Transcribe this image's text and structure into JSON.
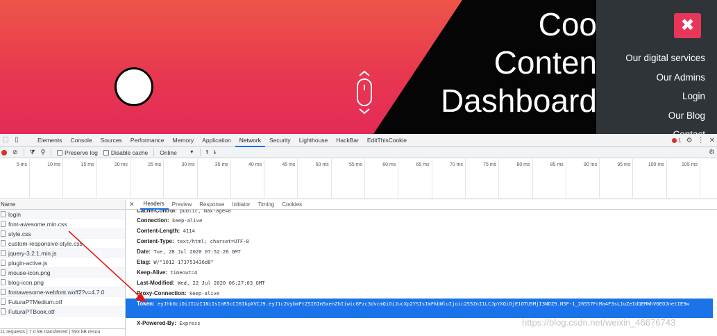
{
  "site": {
    "hero_lines": [
      "Coo",
      "Conten",
      "Dashboard"
    ],
    "menu_close_glyph": "✖",
    "menu_items": [
      "Our digital services",
      "Our Admins",
      "Login",
      "Our Blog",
      "Contact"
    ],
    "colors": {
      "gradient_top": "#ee5548",
      "gradient_bottom": "#e32a58",
      "menu_bg": "#2e3438",
      "close_btn": "#e8365a"
    }
  },
  "devtools": {
    "tabs": [
      "Elements",
      "Console",
      "Sources",
      "Performance",
      "Memory",
      "Application",
      "Network",
      "Security",
      "Lighthouse",
      "HackBar",
      "EditThisCookie"
    ],
    "active_tab": "Network",
    "error_count": "1",
    "toolbar": {
      "preserve_log": "Preserve log",
      "disable_cache": "Disable cache",
      "throttle": "Online"
    },
    "timeline_ticks": [
      "5 ms",
      "10 ms",
      "15 ms",
      "20 ms",
      "25 ms",
      "30 ms",
      "35 ms",
      "40 ms",
      "45 ms",
      "50 ms",
      "55 ms",
      "60 ms",
      "65 ms",
      "70 ms",
      "75 ms",
      "80 ms",
      "85 ms",
      "90 ms",
      "95 ms",
      "100 ms",
      "105 ms"
    ],
    "name_header": "Name",
    "requests": [
      "login",
      "font-awesome.min.css",
      "style.css",
      "custom-responsive-style.css",
      "jquery-3.2.1.min.js",
      "plugin-active.js",
      "mouse-icon.png",
      "blog-icon.png",
      "fontawesome-webfont.woff2?v=4.7.0",
      "FuturaPTMedium.otf",
      "FuturaPTBook.otf"
    ],
    "status_bar": "11 requests | 7.0 kB transferred | 593 kB resou",
    "detail_tabs": [
      "Headers",
      "Preview",
      "Response",
      "Initiator",
      "Timing",
      "Cookies"
    ],
    "active_detail_tab": "Headers",
    "headers": [
      {
        "key": "Cache-Control:",
        "value": "public, max-age=0"
      },
      {
        "key": "Connection:",
        "value": "keep-alive"
      },
      {
        "key": "Content-Length:",
        "value": "4114"
      },
      {
        "key": "Content-Type:",
        "value": "text/html; charset=UTF-8"
      },
      {
        "key": "Date:",
        "value": "Tue, 28 Jul 2020 07:52:26 GMT"
      },
      {
        "key": "Etag:",
        "value": "W/\"1012-173753436d8\""
      },
      {
        "key": "Keep-Alive:",
        "value": "timeout=4"
      },
      {
        "key": "Last-Modified:",
        "value": "Wed, 22 Jul 2020 06:27:03 GMT"
      },
      {
        "key": "Proxy-Connection:",
        "value": "keep-alive"
      },
      {
        "key": "Token:",
        "value": "eyJhbGciOiJIUzI1NiIsInR5cCI6IkpXVCJ9.eyJ1c2VybmFtZSI6Im5xenZhIiwicGFzc3dvcmQiOiJucXp2YSIsImFkbWluIjoic255ZnI1LCJpYXQiOjE1OTU5MjI3NDZ9.N5F-1_26557FcMa4F3sL1uZeIdQEMWhV6EOJnetIE9w"
      },
      {
        "key": "X-Powered-By:",
        "value": "Express"
      }
    ]
  },
  "watermark": "https://blog.csdn.net/weixin_46676743"
}
